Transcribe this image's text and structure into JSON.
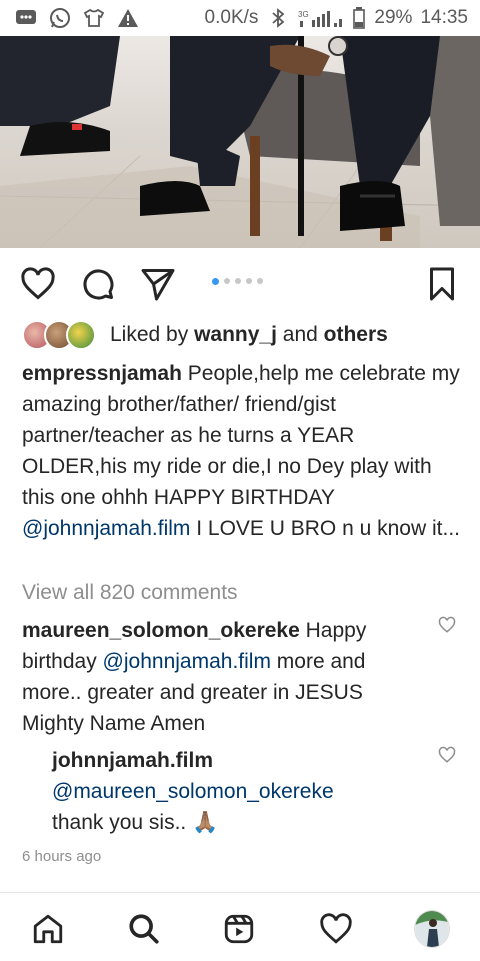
{
  "status_bar": {
    "speed": "0.0K/s",
    "network": "3G",
    "battery": "29%",
    "time": "14:35"
  },
  "post": {
    "image_alt": "",
    "carousel": {
      "count": 5,
      "active_index": 0
    },
    "likes": {
      "prefix": "Liked by ",
      "user": "wanny_j",
      "mid": " and ",
      "suffix": "others"
    },
    "caption": {
      "author": "empressnjamah",
      "text1": " People,help me celebrate my amazing brother/father/ friend/gist partner/teacher as he turns a YEAR OLDER,his my ride or die,I no Dey play with this one ohhh HAPPY BIRTHDAY ",
      "mention": "@johnnjamah.film",
      "text2": " I LOVE U BRO n u know it..."
    },
    "view_all_comments": "View all 820 comments",
    "comments": [
      {
        "author": "maureen_solomon_okereke",
        "text1": " Happy birthday ",
        "mention": "@johnnjamah.film",
        "text2": "  more and more.. greater and greater in JESUS Mighty Name Amen"
      },
      {
        "author": "johnnjamah.film",
        "mention": "@maureen_solomon_okereke",
        "text2": "thank you sis.. 🙏🏽"
      }
    ],
    "timestamp": "6 hours ago"
  },
  "bottom_nav": [
    "home",
    "search",
    "reels",
    "activity",
    "profile"
  ],
  "colors": {
    "link": "#00376b",
    "accent": "#3897f0",
    "muted": "#8e8e8e"
  }
}
